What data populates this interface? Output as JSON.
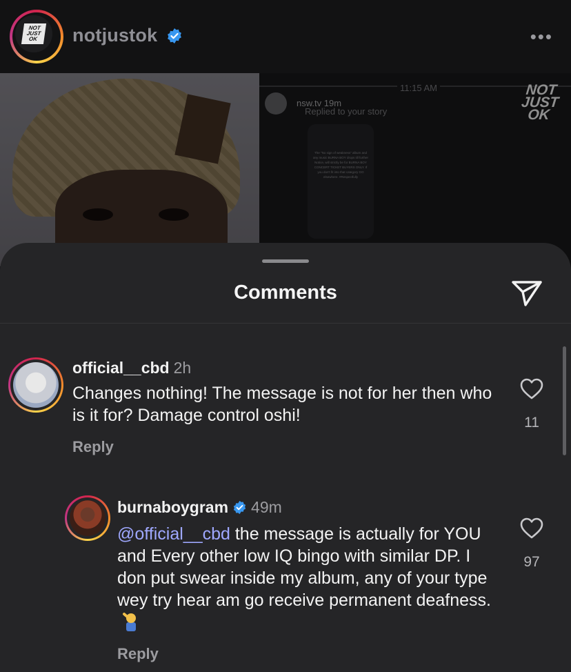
{
  "header": {
    "username": "notjustok",
    "logo_lines": [
      "NOT",
      "JUST",
      "OK"
    ],
    "more_icon": "ellipsis-icon"
  },
  "post_image": {
    "dm_time": "11:15 AM",
    "dm_sender": "nsw.tv",
    "dm_sender_age": "19m",
    "dm_subtitle": "Replied to your story",
    "dm_story_text": "The \"No sign of weakness\" album and any music BURNA BOY drops till further Notice, will strictly be for BURNA BOY CONCERT TICKET BUYERS ONLY. If you don't fit into that category GO elsewhere. #Respectfully",
    "watermark_lines": [
      "NOT",
      "JUST",
      "OK"
    ]
  },
  "comments_sheet": {
    "title": "Comments",
    "share_icon": "send-icon",
    "comments": [
      {
        "username": "official__cbd",
        "time": "2h",
        "text": "Changes nothing! The message is not for her then who is it for? Damage control oshi!",
        "reply_label": "Reply",
        "likes": "11"
      },
      {
        "username": "burnaboygram",
        "verified": true,
        "time": "49m",
        "mention": "@official__cbd",
        "text": " the message is actually for YOU and Every other low IQ bingo with similar DP. I don put swear inside my album, any of your type wey try hear am go receive permanent deafness.",
        "reply_label": "Reply",
        "likes": "97"
      }
    ]
  },
  "colors": {
    "sheet_bg": "#252527",
    "verified_blue": "#3897f0",
    "mention": "#9fa8ff",
    "story_ring": [
      "#d2244d",
      "#f28b2b",
      "#fbd44a",
      "#c13584"
    ]
  }
}
